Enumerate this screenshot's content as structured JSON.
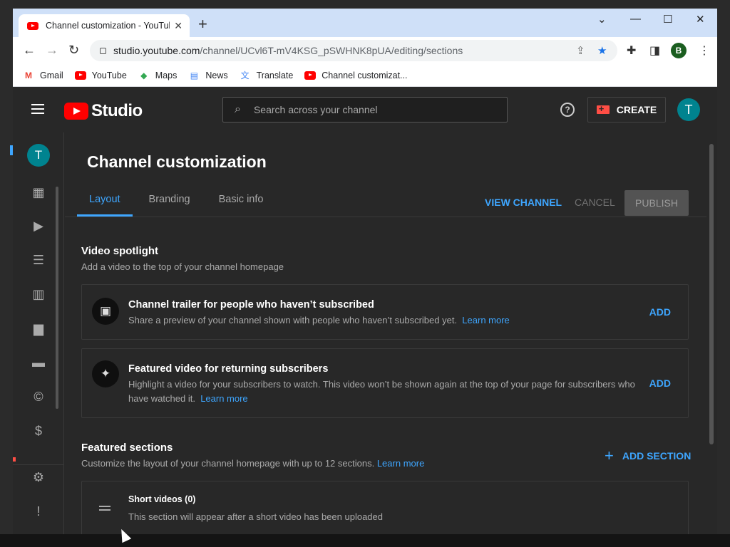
{
  "browser": {
    "tab_title": "Channel customization - YouTube",
    "url_host": "studio.youtube.com",
    "url_path": "/channel/UCvl6T-mV4KSG_pSWHNK8pUA/editing/sections",
    "profile_initial": "B",
    "bookmarks": [
      "Gmail",
      "YouTube",
      "Maps",
      "News",
      "Translate",
      "Channel customizat..."
    ]
  },
  "studio": {
    "logo_text": "Studio",
    "search_placeholder": "Search across your channel",
    "create_label": "CREATE",
    "avatar_initial": "T"
  },
  "sidebar": {
    "avatar_initial": "T",
    "icons": [
      "dashboard-icon",
      "content-icon",
      "playlists-icon",
      "analytics-icon",
      "comments-icon",
      "subtitles-icon",
      "copyright-icon",
      "earn-icon",
      "settings-icon",
      "feedback-icon"
    ]
  },
  "page": {
    "title": "Channel customization",
    "tabs": [
      "Layout",
      "Branding",
      "Basic info"
    ],
    "active_tab": "Layout",
    "view_channel": "VIEW CHANNEL",
    "cancel": "CANCEL",
    "publish": "PUBLISH"
  },
  "spotlight": {
    "title": "Video spotlight",
    "subtitle": "Add a video to the top of your channel homepage",
    "cards": [
      {
        "title": "Channel trailer for people who haven’t subscribed",
        "desc": "Share a preview of your channel shown with people who haven’t subscribed yet.",
        "link": "Learn more",
        "action": "ADD"
      },
      {
        "title": "Featured video for returning subscribers",
        "desc": "Highlight a video for your subscribers to watch. This video won’t be shown again at the top of your page for subscribers who have watched it.",
        "link": "Learn more",
        "action": "ADD"
      }
    ]
  },
  "featured": {
    "title": "Featured sections",
    "subtitle": "Customize the layout of your channel homepage with up to 12 sections.",
    "link": "Learn more",
    "add_section": "ADD SECTION",
    "section_title": "Short videos (0)",
    "section_desc": "This section will appear after a short video has been uploaded"
  },
  "colors": {
    "accent": "#3ea6ff",
    "brand_red": "#ff0000",
    "avatar_teal": "#00838f",
    "bg": "#282828"
  }
}
